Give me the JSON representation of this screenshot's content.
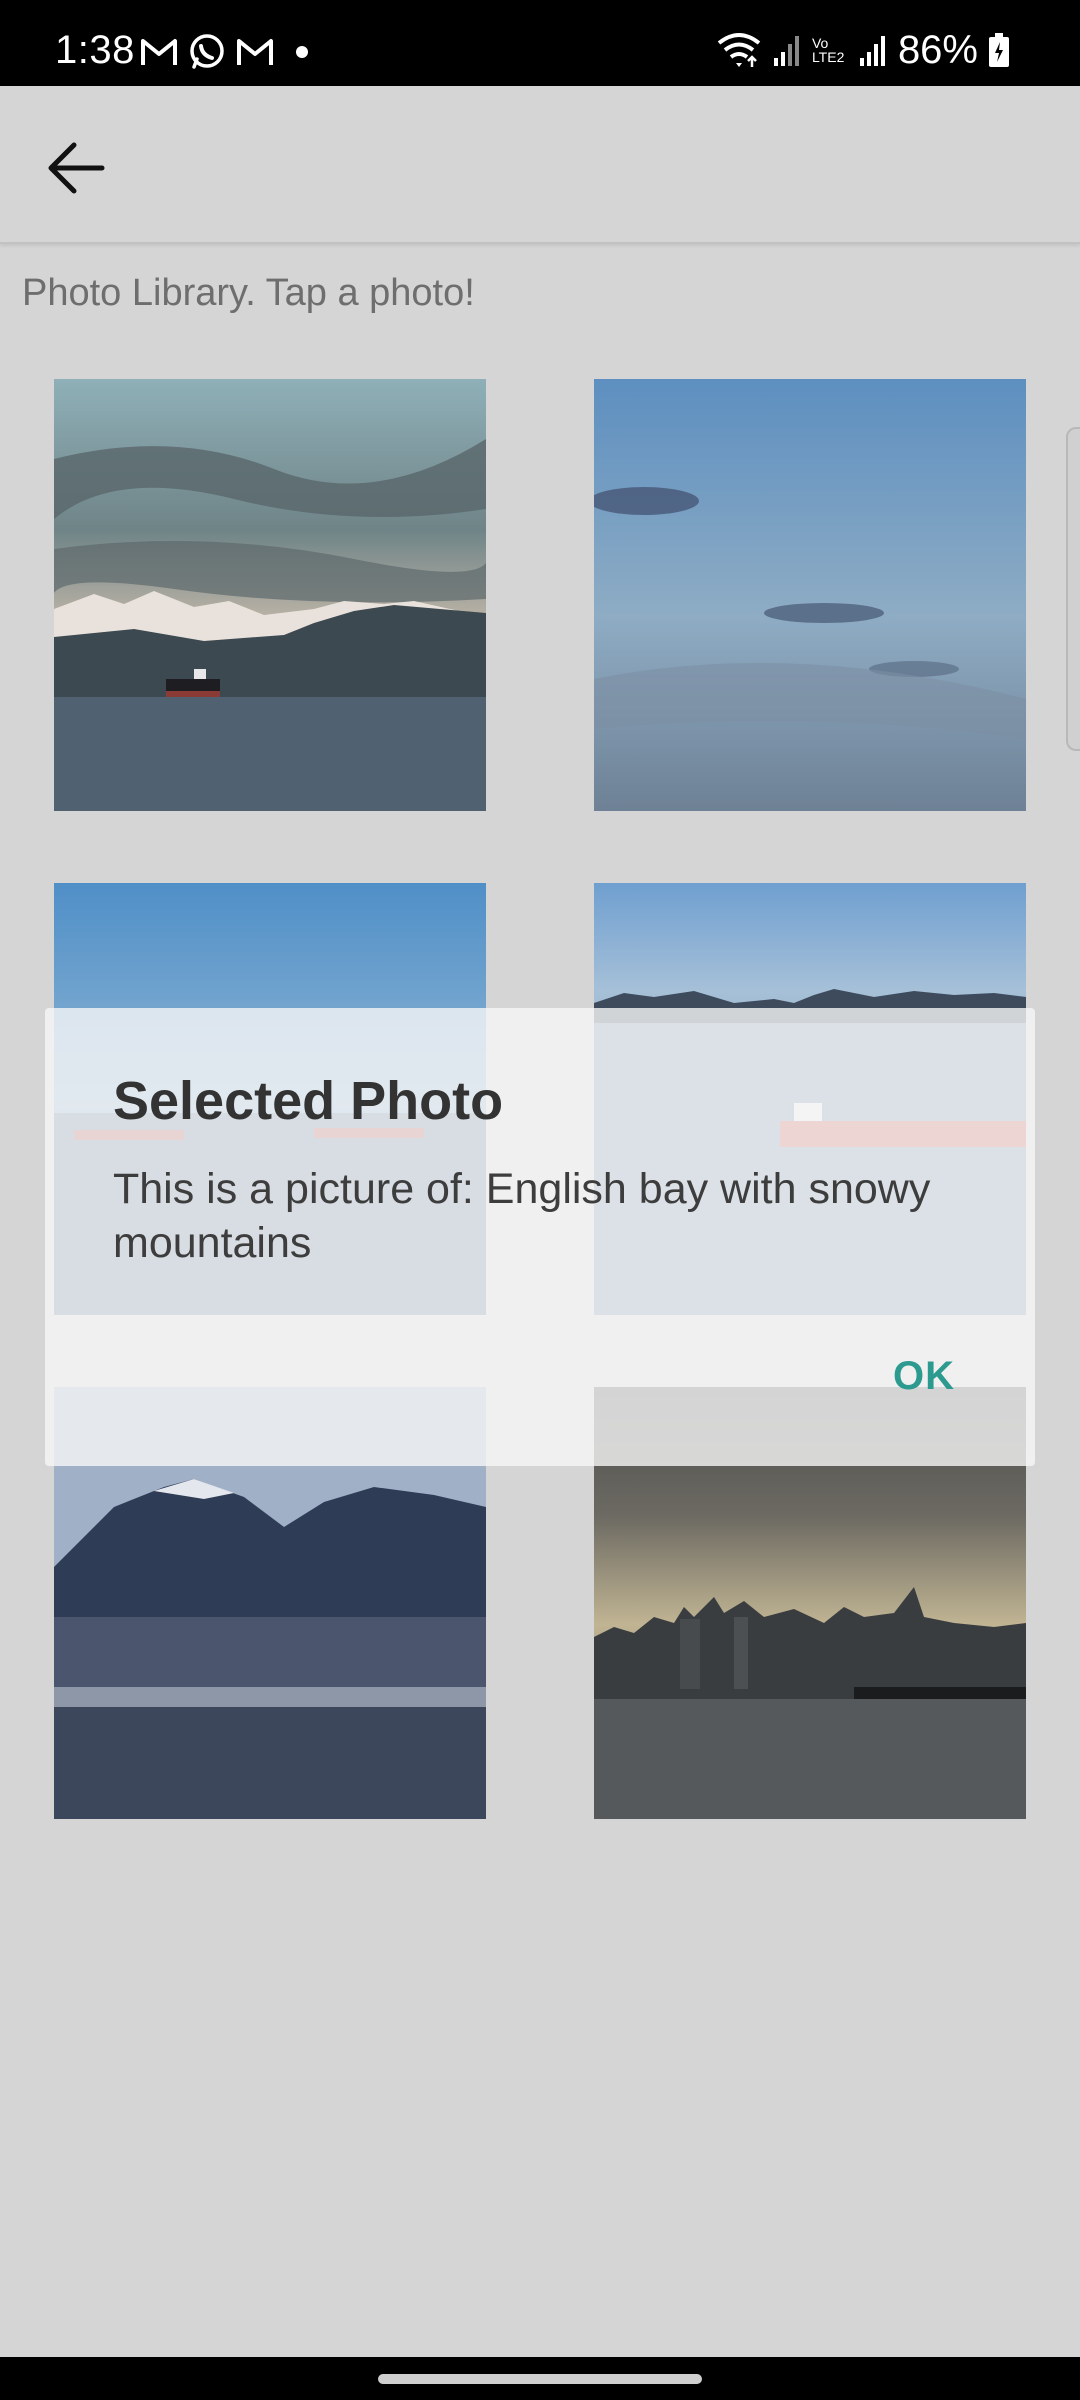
{
  "status_bar": {
    "time": "1:38",
    "notification_icons": [
      "gmail-icon",
      "whatsapp-icon",
      "gmail-icon",
      "dot-icon"
    ],
    "system_icons": [
      "wifi-icon",
      "signal-icon",
      "volte-icon",
      "signal-icon",
      "battery-icon"
    ],
    "volte_label_top": "Vo",
    "volte_label_bottom": "LTE2",
    "battery_percent": "86%"
  },
  "app_bar": {
    "back_icon": "arrow-back-icon"
  },
  "page": {
    "subtitle": "Photo Library. Tap a photo!"
  },
  "photos": [
    "photo-mountains-ship",
    "photo-sky-clouds",
    "photo-bay-ships",
    "photo-bay-tanker",
    "photo-north-shore-mountains",
    "photo-city-skyline"
  ],
  "dialog": {
    "title": "Selected Photo",
    "message": "This is a picture of: English bay with snowy mountains",
    "ok_label": "OK"
  },
  "colors": {
    "background": "#d5d5d5",
    "accent": "#2c9a8f",
    "status_bar": "#000000"
  }
}
